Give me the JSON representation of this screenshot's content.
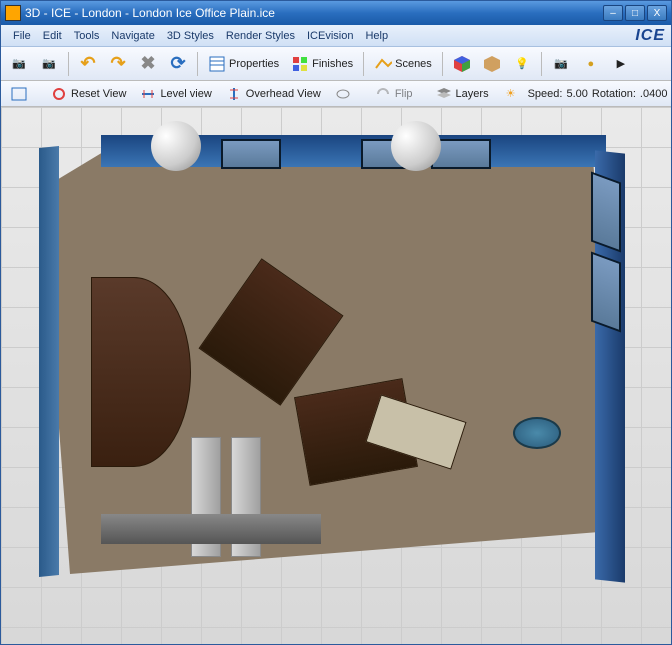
{
  "titlebar": {
    "title": "3D - ICE - London - London Ice Office Plain.ice",
    "minimize": "–",
    "maximize": "□",
    "close": "X"
  },
  "menubar": {
    "items": [
      "File",
      "Edit",
      "Tools",
      "Navigate",
      "3D Styles",
      "Render Styles",
      "ICEvision",
      "Help"
    ],
    "brand": "ICE"
  },
  "toolbar1": {
    "undo": "↶",
    "redo": "↷",
    "cancel": "✖",
    "refresh": "⟳",
    "properties": "Properties",
    "finishes": "Finishes",
    "scenes": "Scenes"
  },
  "toolbar2": {
    "reset_view": "Reset View",
    "level_view": "Level view",
    "overhead_view": "Overhead View",
    "flip": "Flip",
    "layers": "Layers",
    "speed_label": "Speed:",
    "speed_value": "5.00",
    "rotation_label": "Rotation:",
    "rotation_value": ".0400"
  },
  "colors": {
    "accent": "#2a6ebf",
    "wall": "#3a6aaa",
    "floor": "#8a7a66"
  }
}
